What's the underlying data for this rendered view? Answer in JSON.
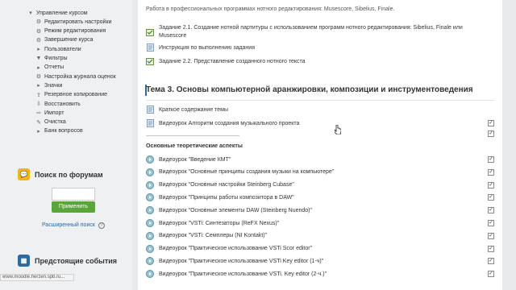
{
  "colors": {
    "link": "#2a6ba1",
    "apply_button": "#5aa638",
    "forum_icon": "#f2b51c",
    "events_icon": "#2a6ba1"
  },
  "nav": {
    "items": [
      {
        "icon": "chevron-down-icon",
        "label": "Управление курсом"
      },
      {
        "icon": "gear-icon",
        "label": "Редактировать настройки"
      },
      {
        "icon": "gear-icon",
        "label": "Режим редактирования"
      },
      {
        "icon": "gear-icon",
        "label": "Завершение курса"
      },
      {
        "icon": "chevron-right-icon",
        "label": "Пользователи"
      },
      {
        "icon": "filter-icon",
        "label": "Фильтры"
      },
      {
        "icon": "chevron-right-icon",
        "label": "Отчеты"
      },
      {
        "icon": "gear-icon",
        "label": "Настройка журнала оценок"
      },
      {
        "icon": "chevron-right-icon",
        "label": "Значки"
      },
      {
        "icon": "backup-icon",
        "label": "Резервное копирование"
      },
      {
        "icon": "restore-icon",
        "label": "Восстановить"
      },
      {
        "icon": "import-icon",
        "label": "Импорт"
      },
      {
        "icon": "trash-icon",
        "label": "Очистка"
      },
      {
        "icon": "chevron-right-icon",
        "label": "Банк вопросов"
      }
    ]
  },
  "forum_search": {
    "title": "Поиск по форумам",
    "search_value": "",
    "apply_label": "Применить",
    "advanced_label": "Расширенный поиск"
  },
  "events": {
    "title": "Предстоящие события"
  },
  "content": {
    "intro_text": "Работа в профессиональных программах нотного редактирования: Musescore, Sibelius, Finale.",
    "prev_items": [
      {
        "icon": "assignment-icon",
        "label": "Задание 2.1. Создание нотной партитуры с использованием программ нотного редактирования: Sibelius, Finale или Musescore"
      },
      {
        "icon": "file-icon",
        "label": "Инструкция по выполнению задания"
      },
      {
        "icon": "assignment-icon",
        "label": "Задание 2.2. Представление созданного нотного текста"
      }
    ],
    "topic_title": "Тема 3. Основы компьютерной аранжировки, композиции и инструментоведения",
    "topic_items": [
      {
        "icon": "file-icon",
        "label": "Краткое содержание темы"
      },
      {
        "icon": "file-icon",
        "label": "Видеоурок Алгоритм создания музыкального проекта"
      }
    ],
    "subheading": "Основные теоретические аспекты",
    "video_items": [
      {
        "label": "Видеоурок \"Введение КМТ\""
      },
      {
        "label": "Видеоурок \"Основные принципы создания музыки на компьютере\""
      },
      {
        "label": "Видеоурок \"Основные настройки Steinberg Cubase\""
      },
      {
        "label": "Видеоурок \"Принципы работы композитора в DAW\""
      },
      {
        "label": "Видеоурок \"Основные элементы DAW (Steinberg Nuendo)\""
      },
      {
        "label": "Видеоурок \"VSTi: Синтезаторы (ReFX Nexus)\""
      },
      {
        "label": "Видеоурок \"VSTi: Семплеры (NI Kontakt)\""
      },
      {
        "label": "Видеоурок \"Практическое использование VSTi Scor editor\""
      },
      {
        "label": "Видеоурок \"Практическое использование VSTi Key editor (1-ч)\""
      },
      {
        "label": "Видеоурок \"Практическое использование VSTi. Key editor (2-ч.)\""
      }
    ]
  },
  "status_url": "www.moodle.herzen.spb.ru..."
}
